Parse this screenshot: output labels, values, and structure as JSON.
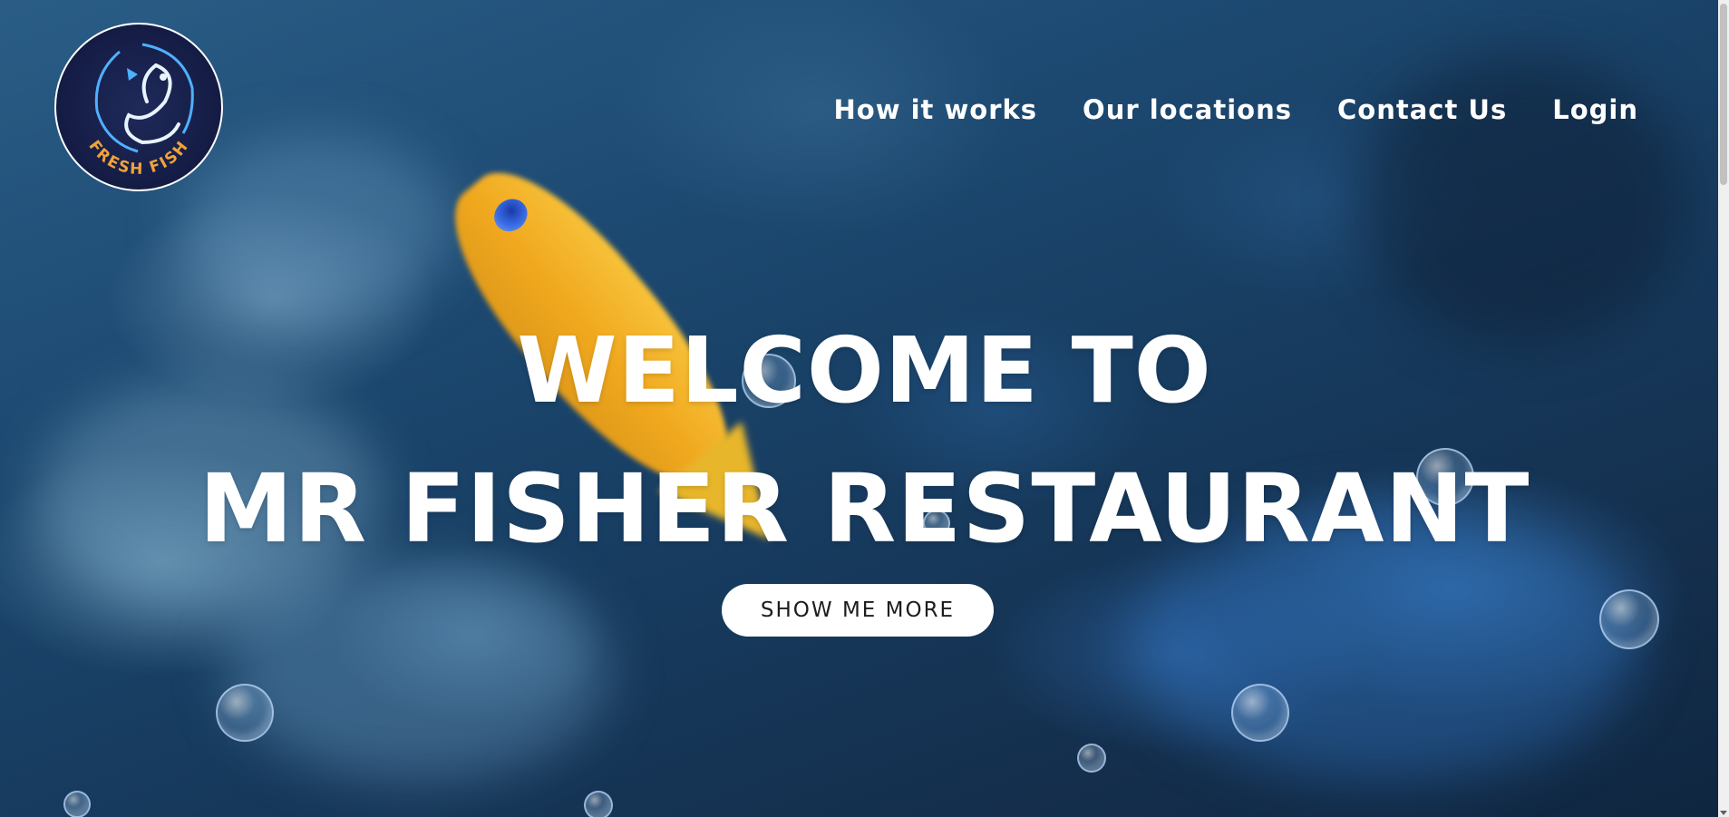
{
  "logo": {
    "text": "FRESH FISH",
    "neon_color": "#4fb0ff",
    "text_color": "#f2a23a"
  },
  "nav": {
    "items": [
      {
        "label": "How it works"
      },
      {
        "label": "Our locations"
      },
      {
        "label": "Contact Us"
      },
      {
        "label": "Login"
      }
    ]
  },
  "hero": {
    "title_line1": "WELCOME TO",
    "title_line2": "MR FISHER RESTAURANT",
    "cta_label": "SHOW ME MORE",
    "background": "underwater scene with yellow fish and bubbles"
  },
  "colors": {
    "background_deep": "#142f4d",
    "background_light": "#2a5d86",
    "text": "#ffffff",
    "fish": "#f0a81e",
    "button_bg": "#ffffff",
    "button_text": "#1d1d1d"
  }
}
